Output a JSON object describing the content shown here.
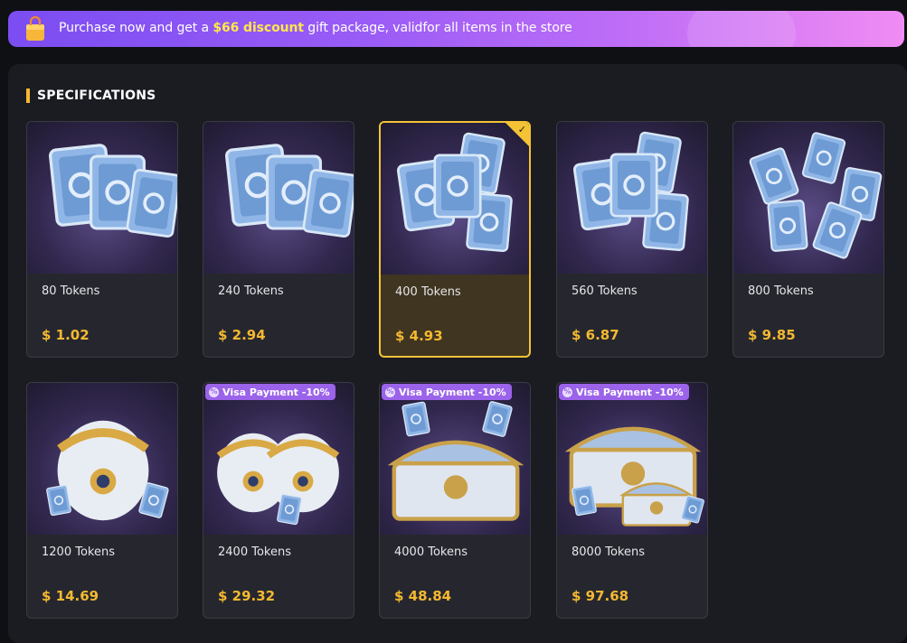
{
  "promo": {
    "prefix": "Purchase now and get a ",
    "highlight": "$66 discount",
    "suffix": " gift package, validfor all items in the store",
    "icon": "shopping-bag-icon"
  },
  "section": {
    "title": "SPECIFICATIONS"
  },
  "products": [
    {
      "name": "80 Tokens",
      "price": "$ 1.02",
      "art": "token-stack-small",
      "badge": "",
      "selected": false
    },
    {
      "name": "240 Tokens",
      "price": "$ 2.94",
      "art": "token-stack-small",
      "badge": "",
      "selected": false
    },
    {
      "name": "400 Tokens",
      "price": "$ 4.93",
      "art": "token-stack-medium",
      "badge": "",
      "selected": true
    },
    {
      "name": "560 Tokens",
      "price": "$ 6.87",
      "art": "token-stack-medium",
      "badge": "",
      "selected": false
    },
    {
      "name": "800 Tokens",
      "price": "$ 9.85",
      "art": "token-pile",
      "badge": "",
      "selected": false
    },
    {
      "name": "1200 Tokens",
      "price": "$ 14.69",
      "art": "token-bag",
      "badge": "",
      "selected": false
    },
    {
      "name": "2400 Tokens",
      "price": "$ 29.32",
      "art": "token-bags",
      "badge": "Visa Payment -10%",
      "selected": false
    },
    {
      "name": "4000 Tokens",
      "price": "$ 48.84",
      "art": "token-chest",
      "badge": "Visa Payment -10%",
      "selected": false
    },
    {
      "name": "8000 Tokens",
      "price": "$ 97.68",
      "art": "token-treasure",
      "badge": "Visa Payment -10%",
      "selected": false
    }
  ],
  "colors": {
    "accent": "#f5b931",
    "selected_border": "#f5c236",
    "badge": "#9b63ea",
    "promo_start": "#7b4df2",
    "promo_end": "#f08cf3"
  }
}
